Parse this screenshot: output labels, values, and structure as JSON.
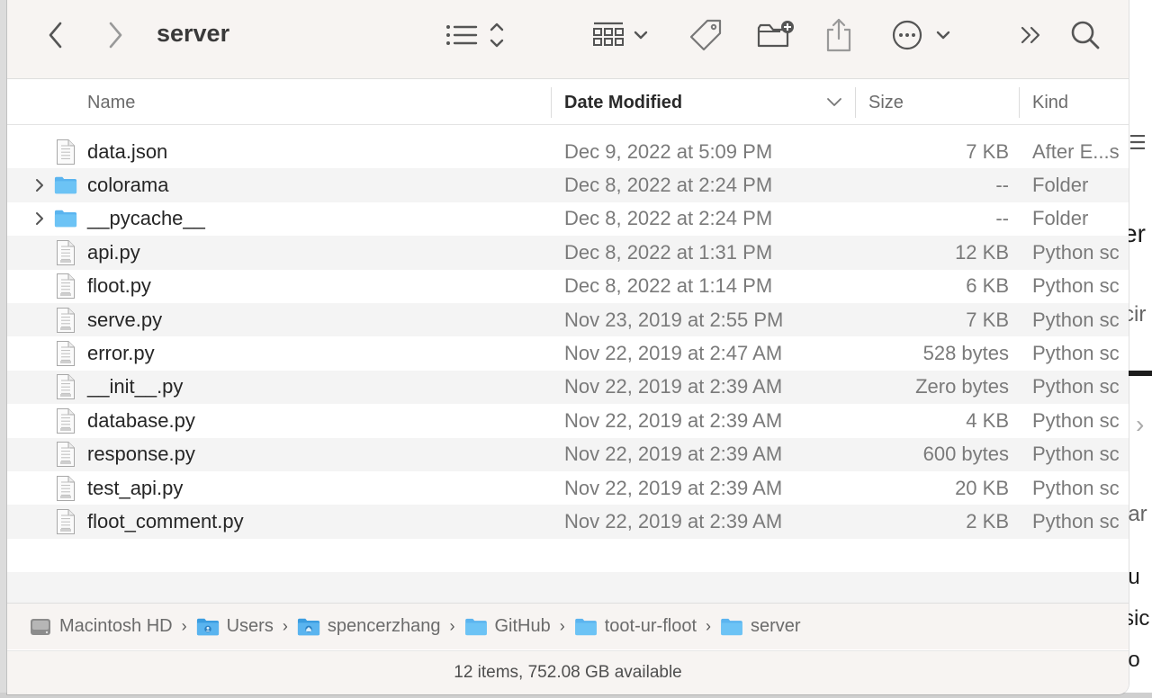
{
  "window": {
    "title": "server"
  },
  "toolbar": {
    "back_icon": "chevron-left-icon",
    "forward_icon": "chevron-right-icon",
    "list_view_icon": "list-view-icon",
    "group_icon": "grid-view-icon",
    "tag_icon": "tag-icon",
    "new_folder_icon": "new-folder-icon",
    "share_icon": "share-icon",
    "more_icon": "ellipsis-circle-icon",
    "overflow_icon": "double-chevron-icon",
    "search_icon": "search-icon"
  },
  "columns": {
    "name": "Name",
    "date_modified": "Date Modified",
    "size": "Size",
    "kind": "Kind"
  },
  "files": [
    {
      "name": "data.json",
      "date": "Dec 9, 2022 at 5:09 PM",
      "size": "7 KB",
      "kind": "After E...s",
      "type": "doc",
      "expandable": false
    },
    {
      "name": "colorama",
      "date": "Dec 8, 2022 at 2:24 PM",
      "size": "--",
      "kind": "Folder",
      "type": "folder",
      "expandable": true
    },
    {
      "name": "__pycache__",
      "date": "Dec 8, 2022 at 2:24 PM",
      "size": "--",
      "kind": "Folder",
      "type": "folder",
      "expandable": true
    },
    {
      "name": "api.py",
      "date": "Dec 8, 2022 at 1:31 PM",
      "size": "12 KB",
      "kind": "Python sc",
      "type": "python",
      "expandable": false
    },
    {
      "name": "floot.py",
      "date": "Dec 8, 2022 at 1:14 PM",
      "size": "6 KB",
      "kind": "Python sc",
      "type": "python",
      "expandable": false
    },
    {
      "name": "serve.py",
      "date": "Nov 23, 2019 at 2:55 PM",
      "size": "7 KB",
      "kind": "Python sc",
      "type": "python",
      "expandable": false
    },
    {
      "name": "error.py",
      "date": "Nov 22, 2019 at 2:47 AM",
      "size": "528 bytes",
      "kind": "Python sc",
      "type": "python",
      "expandable": false
    },
    {
      "name": "__init__.py",
      "date": "Nov 22, 2019 at 2:39 AM",
      "size": "Zero bytes",
      "kind": "Python sc",
      "type": "python",
      "expandable": false
    },
    {
      "name": "database.py",
      "date": "Nov 22, 2019 at 2:39 AM",
      "size": "4 KB",
      "kind": "Python sc",
      "type": "python",
      "expandable": false
    },
    {
      "name": "response.py",
      "date": "Nov 22, 2019 at 2:39 AM",
      "size": "600 bytes",
      "kind": "Python sc",
      "type": "python",
      "expandable": false
    },
    {
      "name": "test_api.py",
      "date": "Nov 22, 2019 at 2:39 AM",
      "size": "20 KB",
      "kind": "Python sc",
      "type": "python",
      "expandable": false
    },
    {
      "name": "floot_comment.py",
      "date": "Nov 22, 2019 at 2:39 AM",
      "size": "2 KB",
      "kind": "Python sc",
      "type": "python",
      "expandable": false
    }
  ],
  "pathbar": [
    {
      "label": "Macintosh HD",
      "icon": "hard-drive-icon"
    },
    {
      "label": "Users",
      "icon": "users-folder-icon"
    },
    {
      "label": "spencerzhang",
      "icon": "home-folder-icon"
    },
    {
      "label": "GitHub",
      "icon": "folder-icon"
    },
    {
      "label": "toot-ur-floot",
      "icon": "folder-icon"
    },
    {
      "label": "server",
      "icon": "folder-icon"
    }
  ],
  "status": {
    "text": "12 items, 752.08 GB available"
  },
  "background_app": {
    "fragments": [
      "er",
      "cir",
      "lar",
      "lu",
      "sic",
      "lo"
    ]
  },
  "colors": {
    "folder_blue": "#5ab4ef",
    "toolbar_bg": "#f7f4f2",
    "row_alt": "#f4f4f4"
  }
}
